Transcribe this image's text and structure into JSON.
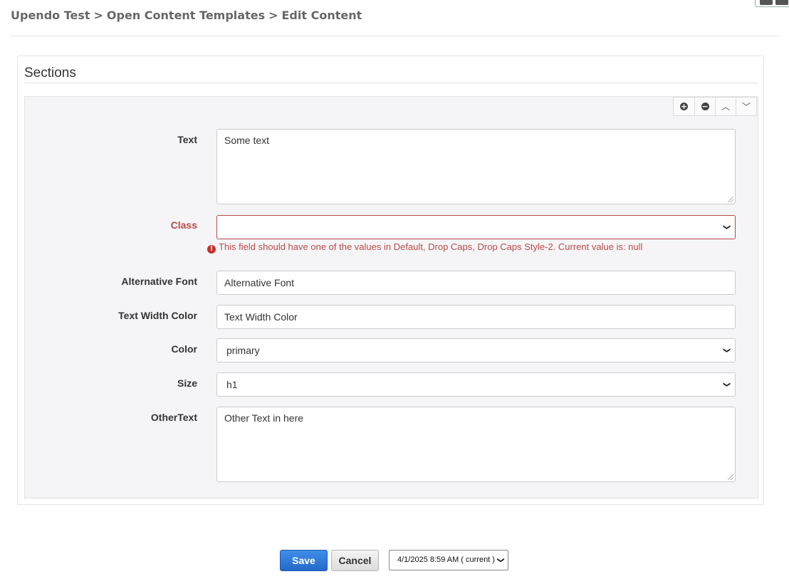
{
  "breadcrumb": {
    "items": [
      "Upendo Test",
      "Open Content Templates",
      "Edit Content"
    ],
    "separator": ">"
  },
  "panel": {
    "title": "Sections",
    "controls": [
      "plus-circle-icon",
      "minus-circle-icon",
      "chevron-up-icon",
      "chevron-down-icon"
    ]
  },
  "form": {
    "text": {
      "label": "Text",
      "value": "Some text"
    },
    "class": {
      "label": "Class",
      "value": "",
      "error": "This field should have one of the values in Default, Drop Caps, Drop Caps Style-2. Current value is: null"
    },
    "alternative_font": {
      "label": "Alternative Font",
      "placeholder": "Alternative Font"
    },
    "text_width_color": {
      "label": "Text Width Color",
      "placeholder": "Text Width Color"
    },
    "color": {
      "label": "Color",
      "value": "primary"
    },
    "size": {
      "label": "Size",
      "value": "h1"
    },
    "other_text": {
      "label": "OtherText",
      "value": "Other Text in here"
    }
  },
  "footer": {
    "save_label": "Save",
    "cancel_label": "Cancel",
    "version_value": "4/1/2025 8:59 AM ( current )"
  },
  "colors": {
    "error": "#b94a48",
    "primary_button": "#2a72d4"
  }
}
